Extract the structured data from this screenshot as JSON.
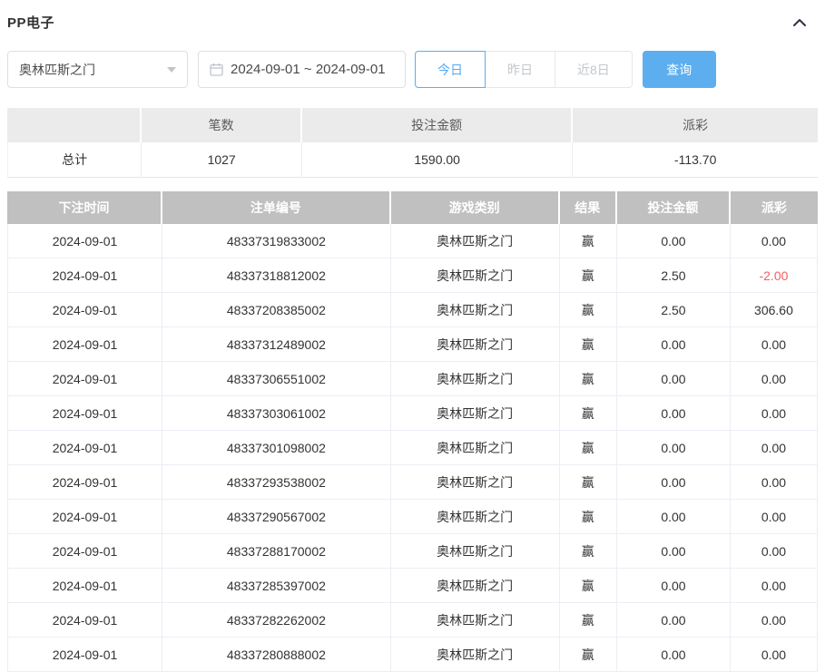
{
  "header": {
    "title": "PP电子",
    "collapse_icon": "chevron-up"
  },
  "filters": {
    "game_select": {
      "value": "奥林匹斯之门"
    },
    "date_range": {
      "value": "2024-09-01 ~ 2024-09-01"
    },
    "quick_buttons": [
      {
        "label": "今日",
        "active": true
      },
      {
        "label": "昨日",
        "active": false
      },
      {
        "label": "近8日",
        "active": false
      }
    ],
    "query_button": "查询"
  },
  "summary": {
    "headers": [
      "",
      "笔数",
      "投注金额",
      "派彩"
    ],
    "total": {
      "label": "总计",
      "count": "1027",
      "bet_amount": "1590.00",
      "payout": "-113.70"
    }
  },
  "table": {
    "headers": [
      "下注时间",
      "注单编号",
      "游戏类别",
      "结果",
      "投注金额",
      "派彩"
    ],
    "rows": [
      [
        "2024-09-01",
        "48337319833002",
        "奥林匹斯之门",
        "赢",
        "0.00",
        "0.00"
      ],
      [
        "2024-09-01",
        "48337318812002",
        "奥林匹斯之门",
        "赢",
        "2.50",
        "-2.00"
      ],
      [
        "2024-09-01",
        "48337208385002",
        "奥林匹斯之门",
        "赢",
        "2.50",
        "306.60"
      ],
      [
        "2024-09-01",
        "48337312489002",
        "奥林匹斯之门",
        "赢",
        "0.00",
        "0.00"
      ],
      [
        "2024-09-01",
        "48337306551002",
        "奥林匹斯之门",
        "赢",
        "0.00",
        "0.00"
      ],
      [
        "2024-09-01",
        "48337303061002",
        "奥林匹斯之门",
        "赢",
        "0.00",
        "0.00"
      ],
      [
        "2024-09-01",
        "48337301098002",
        "奥林匹斯之门",
        "赢",
        "0.00",
        "0.00"
      ],
      [
        "2024-09-01",
        "48337293538002",
        "奥林匹斯之门",
        "赢",
        "0.00",
        "0.00"
      ],
      [
        "2024-09-01",
        "48337290567002",
        "奥林匹斯之门",
        "赢",
        "0.00",
        "0.00"
      ],
      [
        "2024-09-01",
        "48337288170002",
        "奥林匹斯之门",
        "赢",
        "0.00",
        "0.00"
      ],
      [
        "2024-09-01",
        "48337285397002",
        "奥林匹斯之门",
        "赢",
        "0.00",
        "0.00"
      ],
      [
        "2024-09-01",
        "48337282262002",
        "奥林匹斯之门",
        "赢",
        "0.00",
        "0.00"
      ],
      [
        "2024-09-01",
        "48337280888002",
        "奥林匹斯之门",
        "赢",
        "0.00",
        "0.00"
      ]
    ]
  },
  "colors": {
    "primary": "#5caeef",
    "negative": "#f25f5f",
    "table_header_bg": "#c0c0c0",
    "table_header_text": "#ffffff",
    "summary_header_bg": "#ebebeb"
  }
}
